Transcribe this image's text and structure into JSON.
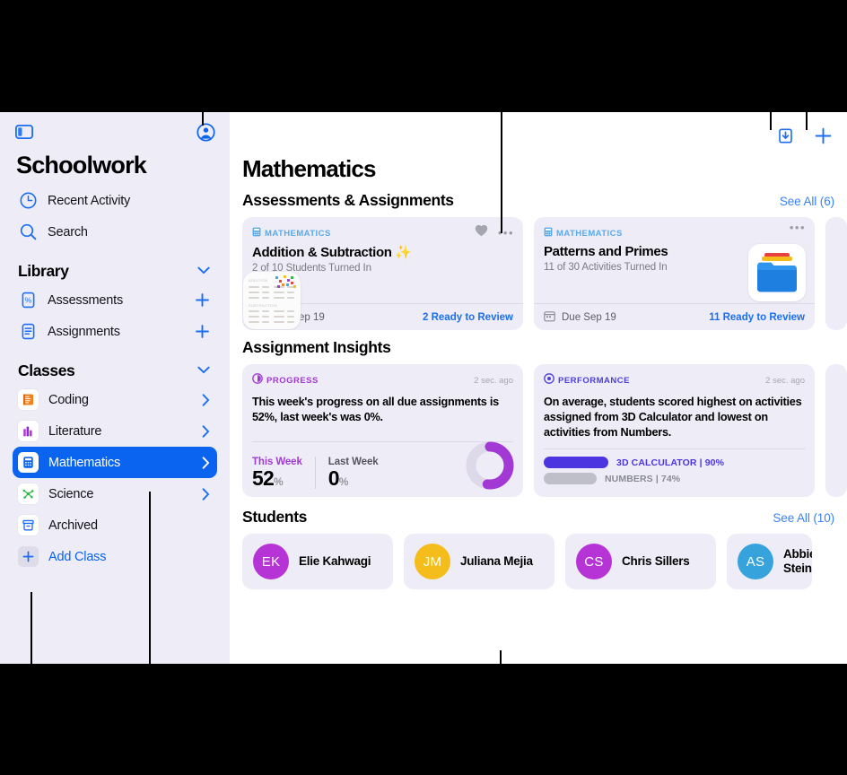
{
  "sidebar": {
    "app_title": "Schoolwork",
    "toggle_icon": "sidebar-toggle-icon",
    "account_icon": "account-circle-icon",
    "top_items": [
      {
        "label": "Recent Activity",
        "icon": "clock-icon"
      },
      {
        "label": "Search",
        "icon": "search-icon"
      }
    ],
    "library": {
      "title": "Library",
      "chevron": "chevron-down-icon",
      "items": [
        {
          "label": "Assessments",
          "icon": "assessment-percent-icon",
          "trailing": "plus-icon"
        },
        {
          "label": "Assignments",
          "icon": "document-lines-icon",
          "trailing": "plus-icon"
        }
      ]
    },
    "classes": {
      "title": "Classes",
      "chevron": "chevron-down-icon",
      "items": [
        {
          "label": "Coding",
          "icon": "coding-scroll-icon",
          "color": "#f08020",
          "trailing": "chevron-right-icon",
          "selected": false
        },
        {
          "label": "Literature",
          "icon": "literature-books-icon",
          "color": "#b43ad6",
          "trailing": "chevron-right-icon",
          "selected": false
        },
        {
          "label": "Mathematics",
          "icon": "calculator-icon",
          "color": "#0a64f0",
          "trailing": "chevron-right-icon",
          "selected": true
        },
        {
          "label": "Science",
          "icon": "molecule-icon",
          "color": "#2fb84a",
          "trailing": "chevron-right-icon",
          "selected": false
        },
        {
          "label": "Archived",
          "icon": "archive-box-icon",
          "color": "#0a64f0",
          "trailing": "",
          "selected": false
        }
      ],
      "add_class": {
        "label": "Add Class",
        "icon": "plus-icon"
      }
    }
  },
  "toolbar": {
    "import_icon": "import-tray-icon",
    "add_icon": "plus-icon"
  },
  "main": {
    "page_title": "Mathematics",
    "assessments": {
      "heading": "Assessments & Assignments",
      "see_all": "See All (6)",
      "cards": [
        {
          "tag": "MATHEMATICS",
          "tag_icon": "calculator-small-icon",
          "title": "Addition & Subtraction ✨",
          "subtitle": "2 of 10 Students Turned In",
          "favorite_icon": "heart-filled-icon",
          "more_icon": "ellipsis-icon",
          "due_icon": "calendar-icon",
          "due": "Due Sep 19",
          "review": "2 Ready to Review",
          "thumb": "worksheet-thumbnail",
          "thumb_headings": [
            "ADDITION",
            "SUBTRACTION"
          ]
        },
        {
          "tag": "MATHEMATICS",
          "tag_icon": "calculator-small-icon",
          "title": "Patterns and Primes",
          "subtitle": "11 of 30 Activities Turned In",
          "favorite_icon": "",
          "more_icon": "ellipsis-icon",
          "due_icon": "calendar-icon",
          "due": "Due Sep 19",
          "review": "11 Ready to Review",
          "thumb": "folder-thumbnail",
          "thumb_headings": []
        }
      ]
    },
    "insights": {
      "heading": "Assignment Insights",
      "progress": {
        "kind": "PROGRESS",
        "kind_icon": "progress-circle-icon",
        "kind_color": "#a339d4",
        "timestamp": "2 sec. ago",
        "body": "This week's progress on all due assignments is 52%, last week's was 0%.",
        "stats": [
          {
            "key": "This Week",
            "value": "52",
            "unit": "%"
          },
          {
            "key": "Last Week",
            "value": "0",
            "unit": "%"
          }
        ],
        "ring_icon": "progress-ring",
        "ring_percent": 52,
        "ring_color": "#a339d4",
        "ring_track": "#ddd9ea"
      },
      "performance": {
        "kind": "PERFORMANCE",
        "kind_icon": "target-icon",
        "kind_color": "#4b3fd8",
        "timestamp": "2 sec. ago",
        "body": "On average, students scored highest on activities assigned from 3D Calculator and lowest on activities from Numbers.",
        "bars": [
          {
            "label": "3D CALCULATOR",
            "separator": "|",
            "value": "90%",
            "pct": 90,
            "color": "#4b35e0",
            "label_color": "#4b35e0",
            "width": 72
          },
          {
            "label": "NUMBERS",
            "separator": "|",
            "value": "74%",
            "pct": 74,
            "color": "#bfbfc9",
            "label_color": "#8a8a95",
            "width": 59
          }
        ]
      }
    },
    "students": {
      "heading": "Students",
      "see_all": "See All (10)",
      "list": [
        {
          "initials": "EK",
          "name": "Elie Kahwagi",
          "color": "#b634d6"
        },
        {
          "initials": "JM",
          "name": "Juliana Mejia",
          "color": "#f5bd1c"
        },
        {
          "initials": "CS",
          "name": "Chris Sillers",
          "color": "#b634d6"
        },
        {
          "initials": "AS",
          "name": "Abbie Stein",
          "color": "#36a3dd"
        }
      ]
    }
  }
}
